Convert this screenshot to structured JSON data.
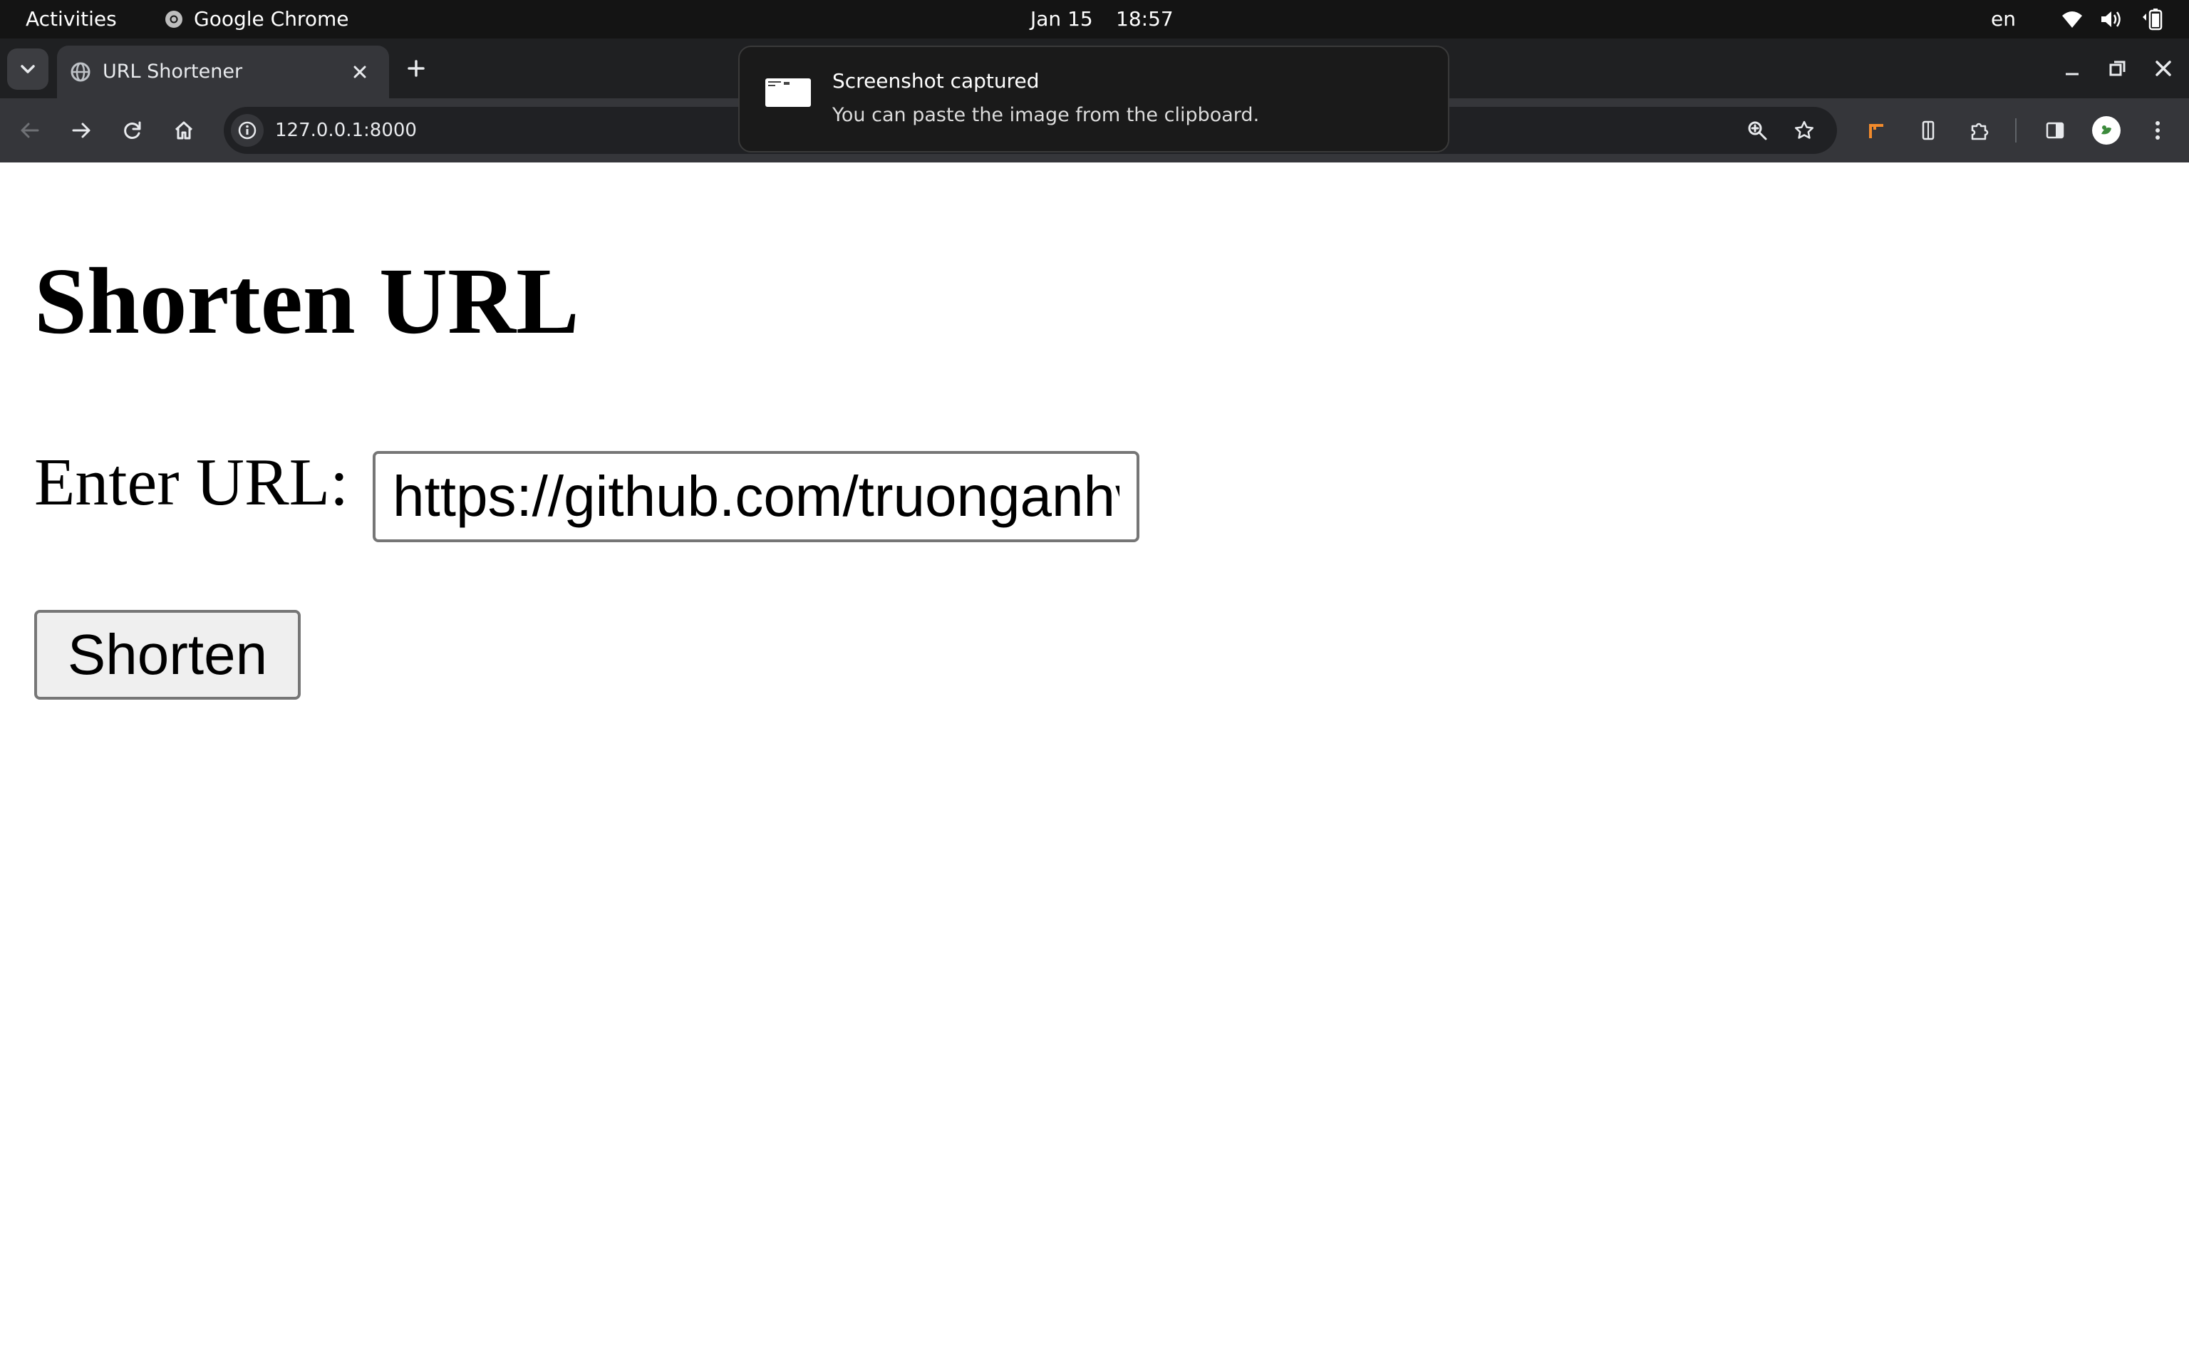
{
  "system_bar": {
    "activities": "Activities",
    "app_name": "Google Chrome",
    "date": "Jan 15",
    "time": "18:57",
    "language": "en"
  },
  "browser": {
    "tab_title": "URL Shortener",
    "address": "127.0.0.1:8000"
  },
  "notification": {
    "title": "Screenshot captured",
    "body": "You can paste the image from the clipboard."
  },
  "page": {
    "heading": "Shorten URL",
    "input_label": "Enter URL:",
    "input_value": "https://github.com/truonganhv",
    "button_label": "Shorten"
  },
  "colors": {
    "accent_orange": "#f28b2c",
    "profile_green": "#3c8a3c"
  }
}
